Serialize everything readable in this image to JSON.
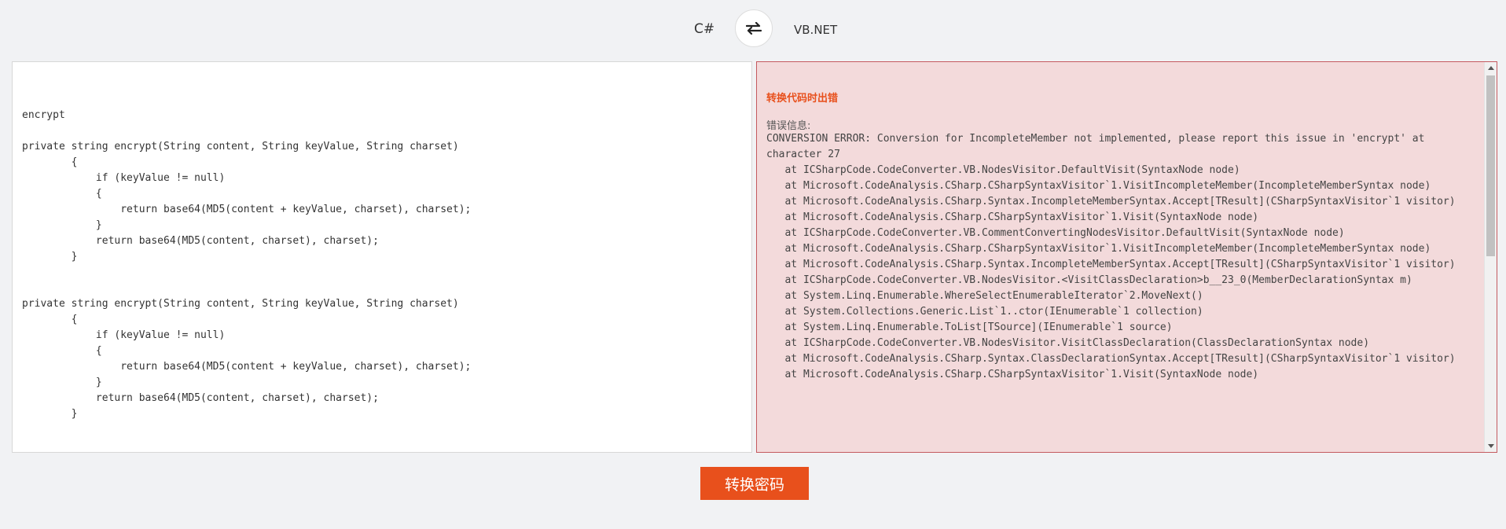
{
  "header": {
    "source_lang": "C#",
    "target_lang": "VB.NET",
    "swap_icon": "swap-arrows-icon"
  },
  "editor": {
    "code": "encrypt\n\nprivate string encrypt(String content, String keyValue, String charset)\n        {\n            if (keyValue != null)\n            {\n                return base64(MD5(content + keyValue, charset), charset);\n            }\n            return base64(MD5(content, charset), charset);\n        }\n\n\nprivate string encrypt(String content, String keyValue, String charset)\n        {\n            if (keyValue != null)\n            {\n                return base64(MD5(content + keyValue, charset), charset);\n            }\n            return base64(MD5(content, charset), charset);\n        }"
  },
  "output": {
    "error_title": "转换代码时出错",
    "error_label": "错误信息:",
    "error_text": "CONVERSION ERROR: Conversion for IncompleteMember not implemented, please report this issue in 'encrypt' at character 27\n   at ICSharpCode.CodeConverter.VB.NodesVisitor.DefaultVisit(SyntaxNode node)\n   at Microsoft.CodeAnalysis.CSharp.CSharpSyntaxVisitor`1.VisitIncompleteMember(IncompleteMemberSyntax node)\n   at Microsoft.CodeAnalysis.CSharp.Syntax.IncompleteMemberSyntax.Accept[TResult](CSharpSyntaxVisitor`1 visitor)\n   at Microsoft.CodeAnalysis.CSharp.CSharpSyntaxVisitor`1.Visit(SyntaxNode node)\n   at ICSharpCode.CodeConverter.VB.CommentConvertingNodesVisitor.DefaultVisit(SyntaxNode node)\n   at Microsoft.CodeAnalysis.CSharp.CSharpSyntaxVisitor`1.VisitIncompleteMember(IncompleteMemberSyntax node)\n   at Microsoft.CodeAnalysis.CSharp.Syntax.IncompleteMemberSyntax.Accept[TResult](CSharpSyntaxVisitor`1 visitor)\n   at ICSharpCode.CodeConverter.VB.NodesVisitor.<VisitClassDeclaration>b__23_0(MemberDeclarationSyntax m)\n   at System.Linq.Enumerable.WhereSelectEnumerableIterator`2.MoveNext()\n   at System.Collections.Generic.List`1..ctor(IEnumerable`1 collection)\n   at System.Linq.Enumerable.ToList[TSource](IEnumerable`1 source)\n   at ICSharpCode.CodeConverter.VB.NodesVisitor.VisitClassDeclaration(ClassDeclarationSyntax node)\n   at Microsoft.CodeAnalysis.CSharp.Syntax.ClassDeclarationSyntax.Accept[TResult](CSharpSyntaxVisitor`1 visitor)\n   at Microsoft.CodeAnalysis.CSharp.CSharpSyntaxVisitor`1.Visit(SyntaxNode node)"
  },
  "actions": {
    "convert_label": "转换密码"
  },
  "colors": {
    "accent": "#e8501c",
    "error_bg": "#f3dadb",
    "error_border": "#c45a5f"
  }
}
